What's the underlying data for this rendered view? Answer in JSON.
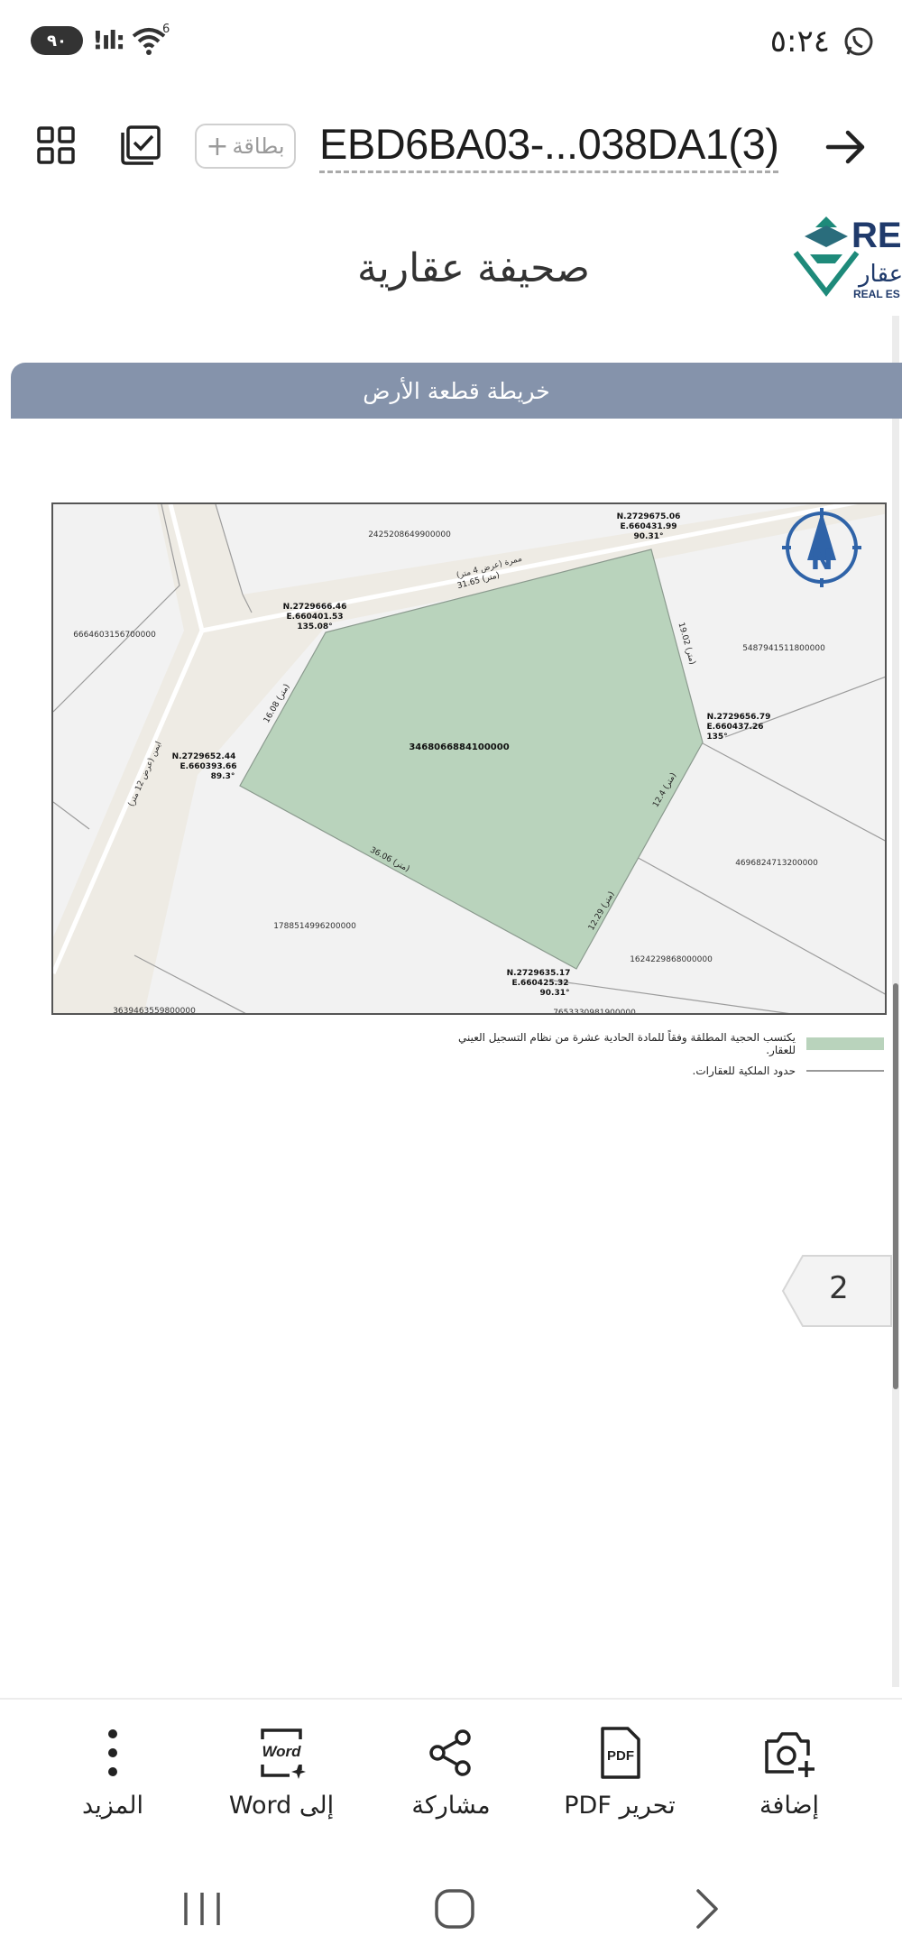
{
  "status_bar": {
    "time": "٥:٢٤",
    "battery": "٩٠",
    "signal_text": "!ıl:",
    "network_badge": "6",
    "icons": [
      "whatsapp-icon",
      "wifi-icon",
      "signal-icon",
      "battery-icon"
    ]
  },
  "toolbar": {
    "title": "EBD6BA03-...038DA1(3)",
    "card_label": "بطاقة",
    "card_plus": "+",
    "icons": [
      "grid-view-icon",
      "select-check-icon",
      "back-arrow-icon"
    ]
  },
  "document": {
    "logo_text_top": "RE",
    "logo_text_mid": "عقار",
    "logo_text_bottom": "REAL ES",
    "heading": "صحيفة عقارية",
    "section_title": "خريطة قطعة الأرض",
    "parcel_id": "3468066884100000",
    "neighbor_ids": [
      "2425208649900000",
      "6664603156700000",
      "5487941511800000",
      "4696824713200000",
      "1624229868000000",
      "1788514996200000",
      "3639463559800000",
      "7653330981900000"
    ],
    "points": [
      {
        "n": "N.2729675.06",
        "e": "E.660431.99",
        "angle": "90.31°"
      },
      {
        "n": "N.2729666.46",
        "e": "E.660401.53",
        "angle": "135.08°"
      },
      {
        "n": "N.2729656.79",
        "e": "E.660437.26",
        "angle": "135°"
      },
      {
        "n": "N.2729652.44",
        "e": "E.660393.66",
        "angle": "89.3°"
      },
      {
        "n": "N.2729635.17",
        "e": "E.660425.32",
        "angle": "90.31°"
      }
    ],
    "edges": [
      "31.65 (متر)",
      "19.02 (متر)",
      "16.08 (متر)",
      "12.4 (متر)",
      "36.06 (متر)",
      "12.29 (متر)"
    ],
    "roads": [
      "ممرة (عرض 4 متر)",
      "ايمن (عرض 12 متر)"
    ],
    "compass_letter": "N",
    "legend": [
      "يكتسب الحجية المطلقة وفقاً للمادة الحادية عشرة من نظام التسجيل العيني للعقار.",
      "حدود الملكية للعقارات."
    ],
    "page_number": "2",
    "colors": {
      "parcel": "#b9d3bc",
      "section_bar": "#8593ab",
      "compass": "#2f63a8",
      "road": "#eeebe4"
    }
  },
  "bottom_bar": {
    "items": [
      {
        "label": "إضافة",
        "icon": "add-camera-icon"
      },
      {
        "label": "تحرير PDF",
        "icon": "pdf-edit-icon",
        "icon_text": "PDF"
      },
      {
        "label": "مشاركة",
        "icon": "share-icon"
      },
      {
        "label": "إلى Word",
        "icon": "word-convert-icon",
        "icon_text": "Word"
      },
      {
        "label": "المزيد",
        "icon": "more-icon"
      }
    ]
  },
  "nav_bar": {
    "icons": [
      "recent-apps-icon",
      "home-icon",
      "back-icon"
    ]
  }
}
